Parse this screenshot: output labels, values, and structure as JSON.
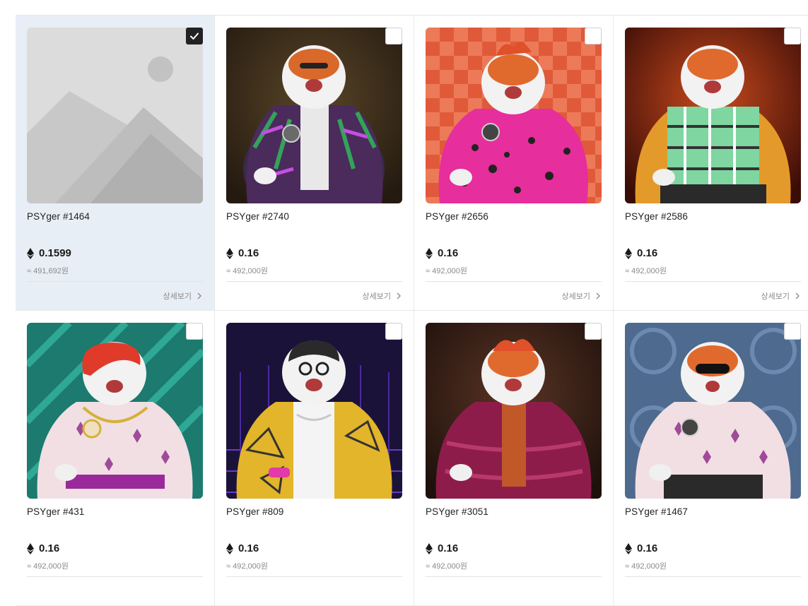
{
  "currency_icon": "ethereum-icon",
  "detail_label": "상세보기",
  "colors": {
    "selected_bg": "#e8eef6",
    "check_on": "#222222"
  },
  "cards": [
    {
      "name": "PSYger #1464",
      "price": "0.1599",
      "krw": "≈ 491,692원",
      "selected": true,
      "image": "image-placeholder-icon"
    },
    {
      "name": "PSYger #2740",
      "price": "0.16",
      "krw": "≈ 492,000원",
      "selected": false,
      "image": "tiger-nft-purple-jacket"
    },
    {
      "name": "PSYger #2656",
      "price": "0.16",
      "krw": "≈ 492,000원",
      "selected": false,
      "image": "tiger-nft-pink-leopard-jacket"
    },
    {
      "name": "PSYger #2586",
      "price": "0.16",
      "krw": "≈ 492,000원",
      "selected": false,
      "image": "tiger-nft-plaid-jacket"
    },
    {
      "name": "PSYger #431",
      "price": "0.16",
      "krw": "≈ 492,000원",
      "selected": false,
      "image": "tiger-nft-star-sweater-red-hair"
    },
    {
      "name": "PSYger #809",
      "price": "0.16",
      "krw": "≈ 492,000원",
      "selected": false,
      "image": "tiger-nft-yellow-jacket"
    },
    {
      "name": "PSYger #3051",
      "price": "0.16",
      "krw": "≈ 492,000원",
      "selected": false,
      "image": "tiger-nft-maroon-puffer"
    },
    {
      "name": "PSYger #1467",
      "price": "0.16",
      "krw": "≈ 492,000원",
      "selected": false,
      "image": "tiger-nft-star-sweater-sunglasses"
    }
  ]
}
